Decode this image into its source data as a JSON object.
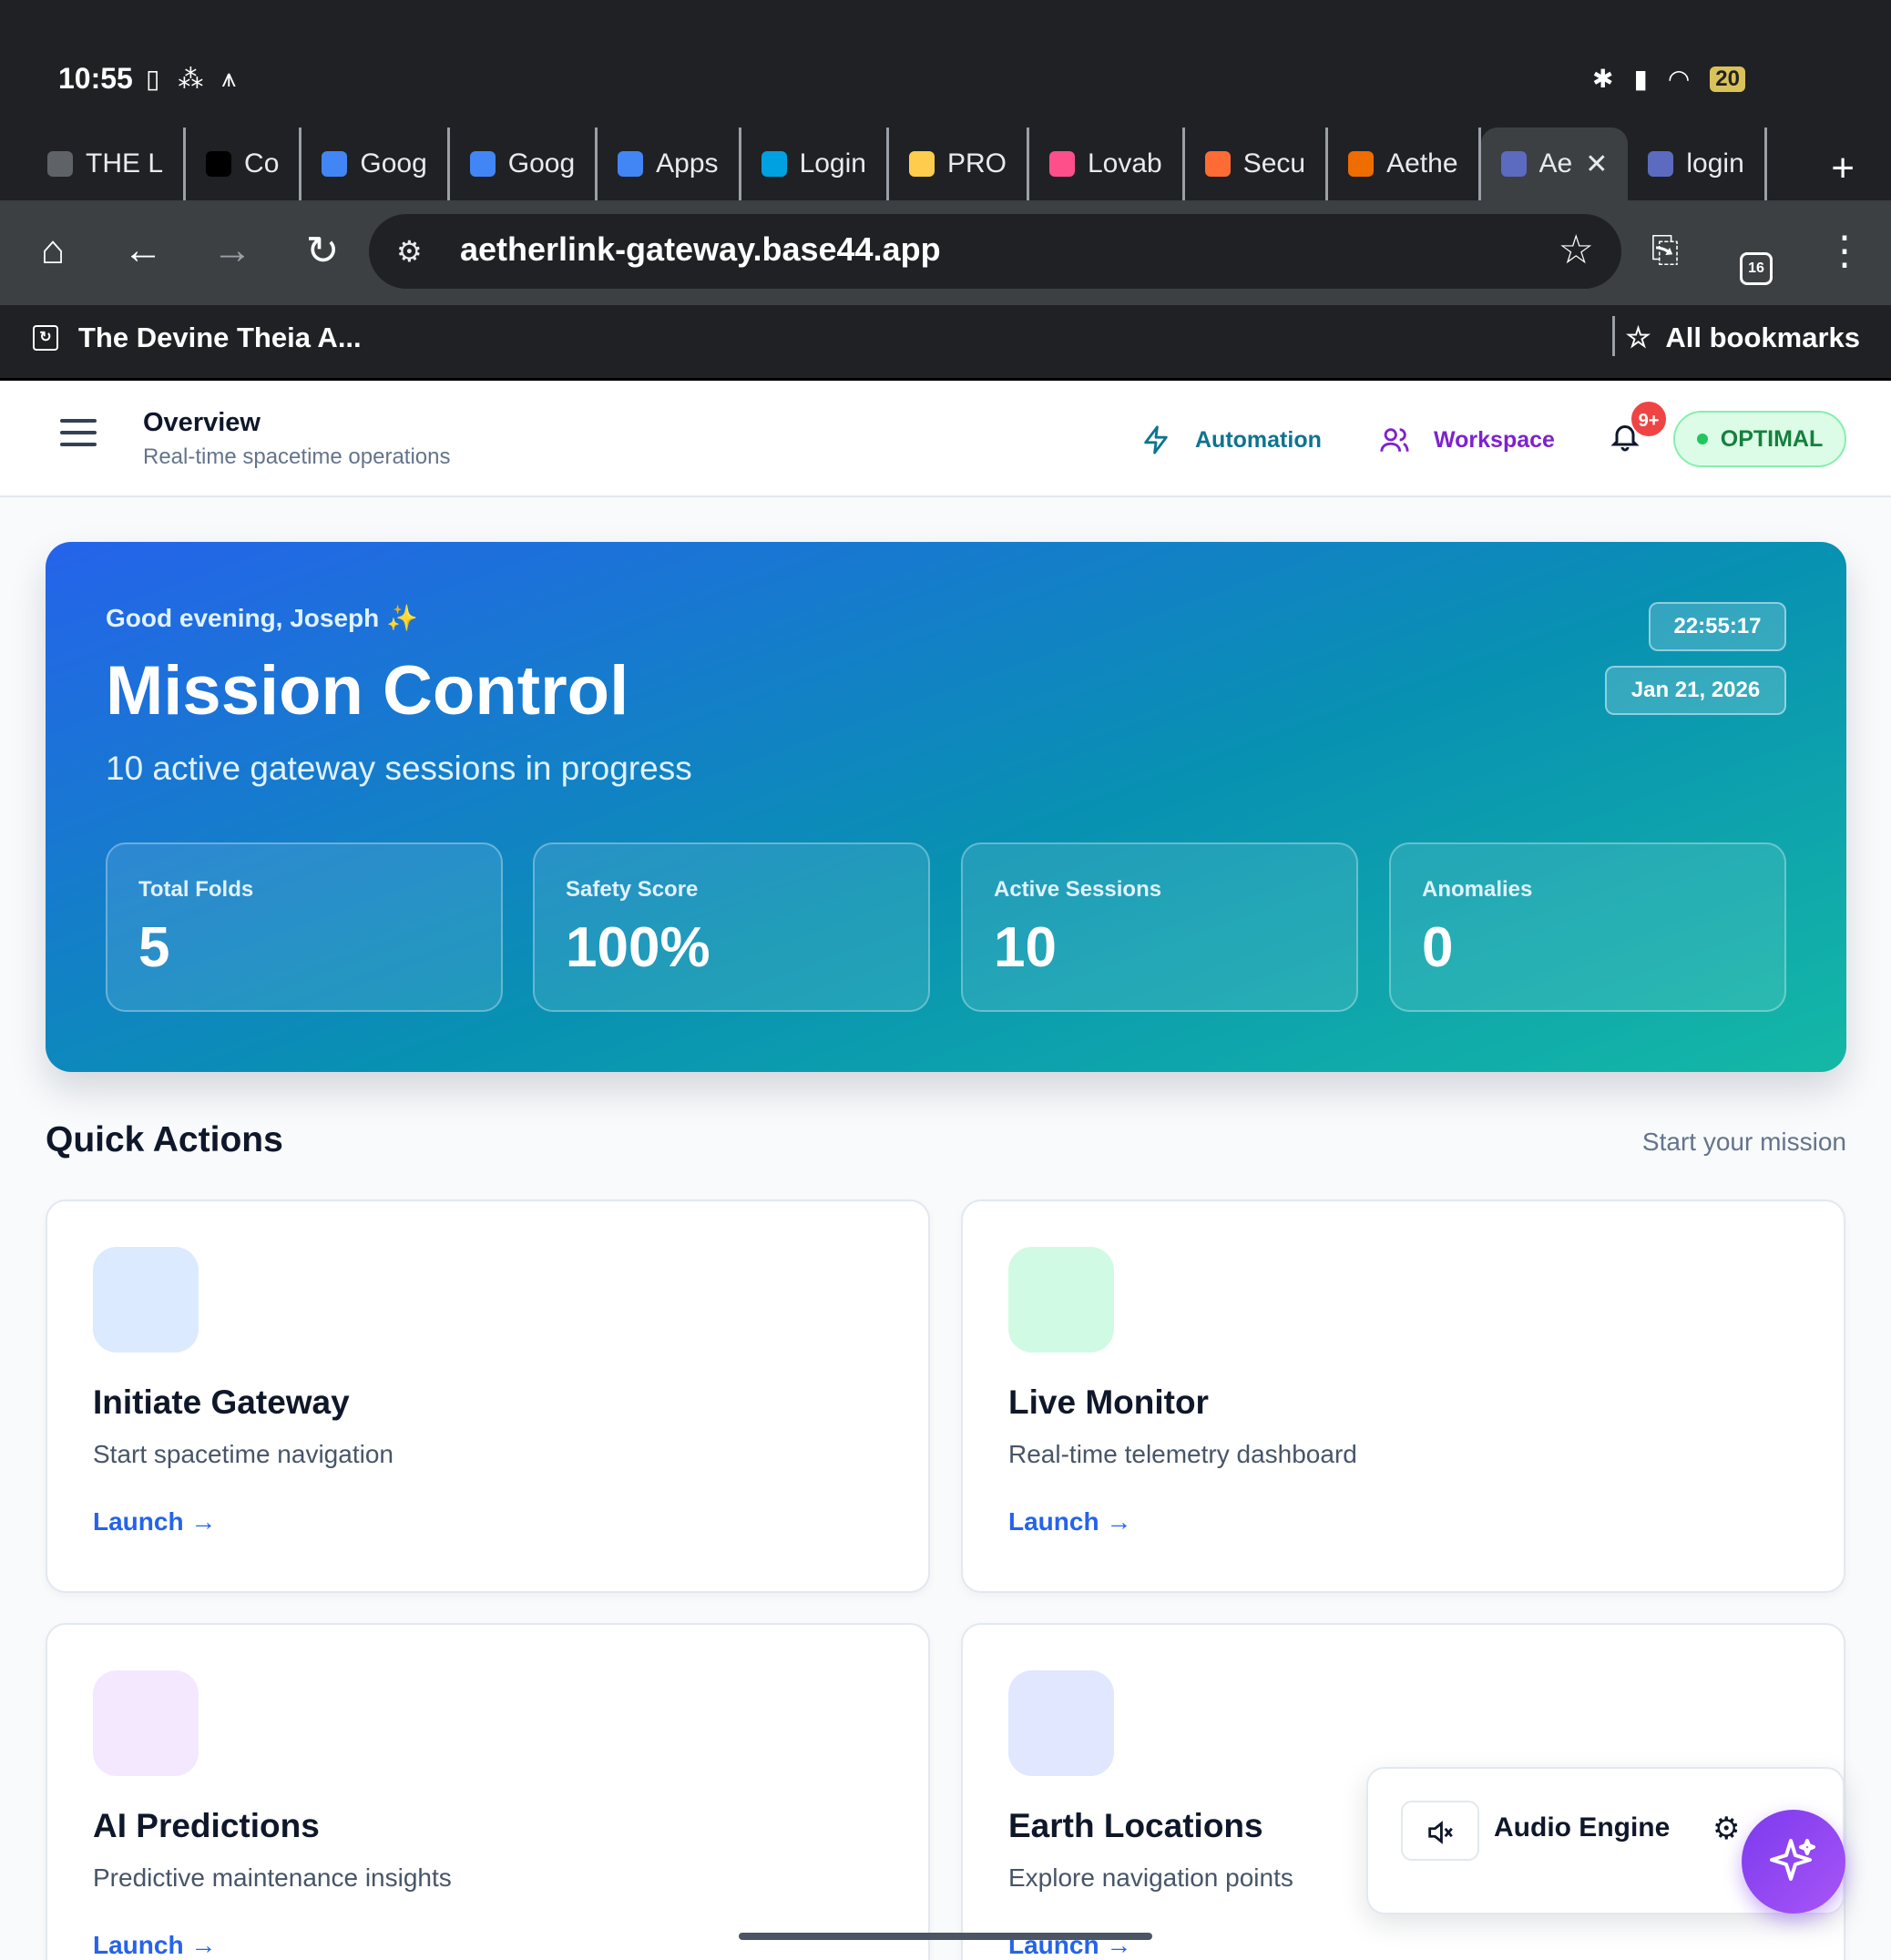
{
  "status_bar": {
    "time": "10:55",
    "battery": "20"
  },
  "tabs": [
    {
      "label": "THE L",
      "favicon_color": "#5f6368"
    },
    {
      "label": "Co",
      "favicon_color": "#000000"
    },
    {
      "label": "Goog",
      "favicon_color": "#4285f4"
    },
    {
      "label": "Goog",
      "favicon_color": "#4285f4"
    },
    {
      "label": "Apps",
      "favicon_color": "#4285f4"
    },
    {
      "label": "Login",
      "favicon_color": "#00a1e0"
    },
    {
      "label": "PRO",
      "favicon_color": "#ffcc4d"
    },
    {
      "label": "Lovab",
      "favicon_color": "#ff4f8b"
    },
    {
      "label": "Secu",
      "favicon_color": "#ff6b35"
    },
    {
      "label": "Aethe",
      "favicon_color": "#ef6c00"
    },
    {
      "label": "Ae",
      "favicon_color": "#5c6bc0",
      "active": true
    },
    {
      "label": "login",
      "favicon_color": "#5c6bc0"
    }
  ],
  "browser": {
    "url": "aetherlink-gateway.base44.app",
    "tab_count": "16",
    "bookmark_left": "The Devine Theia A...",
    "bookmark_right": "All bookmarks"
  },
  "header": {
    "title": "Overview",
    "subtitle": "Real-time spacetime operations",
    "automation_label": "Automation",
    "workspace_label": "Workspace",
    "notification_count": "9+",
    "status_label": "OPTIMAL"
  },
  "hero": {
    "greeting": "Good evening, Joseph ✨",
    "title": "Mission Control",
    "subtitle": "10 active gateway sessions in progress",
    "time": "22:55:17",
    "date": "Jan 21, 2026",
    "stats": [
      {
        "label": "Total Folds",
        "value": "5"
      },
      {
        "label": "Safety Score",
        "value": "100%"
      },
      {
        "label": "Active Sessions",
        "value": "10"
      },
      {
        "label": "Anomalies",
        "value": "0"
      }
    ]
  },
  "quick_actions": {
    "title": "Quick Actions",
    "subtitle": "Start your mission",
    "cards": [
      {
        "title": "Initiate Gateway",
        "desc": "Start spacetime navigation",
        "link": "Launch",
        "icon_bg": "#dbeafe"
      },
      {
        "title": "Live Monitor",
        "desc": "Real-time telemetry dashboard",
        "link": "Launch",
        "icon_bg": "#d1fae5"
      },
      {
        "title": "AI Predictions",
        "desc": "Predictive maintenance insights",
        "link": "Launch",
        "icon_bg": "#f3e8ff"
      },
      {
        "title": "Earth Locations",
        "desc": "Explore navigation points",
        "link": "Launch",
        "icon_bg": "#e0e7ff"
      }
    ]
  },
  "audio_engine": {
    "label": "Audio Engine"
  }
}
